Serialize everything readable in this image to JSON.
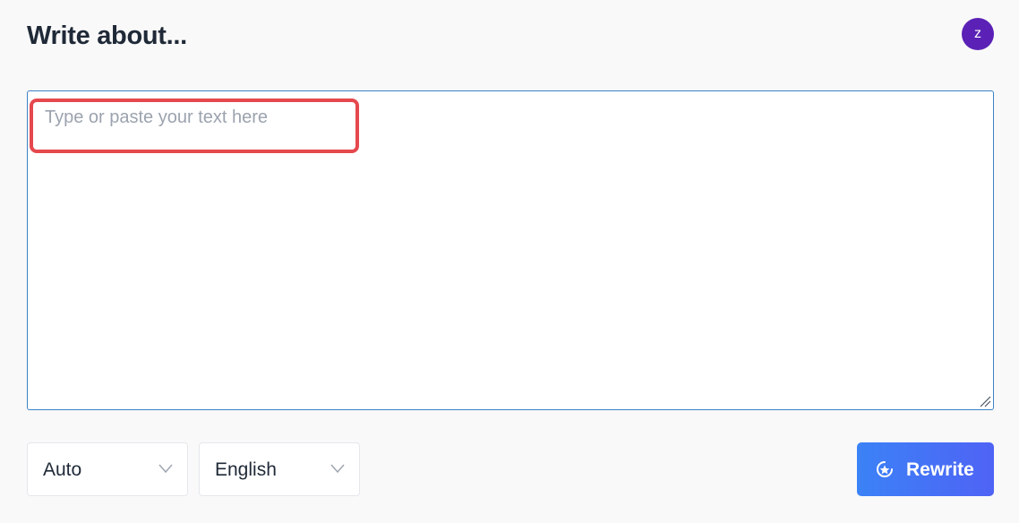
{
  "header": {
    "title": "Write about...",
    "avatar_initial": "z"
  },
  "editor": {
    "placeholder": "Type or paste your text here",
    "value": ""
  },
  "controls": {
    "tone_select": {
      "selected": "Auto"
    },
    "language_select": {
      "selected": "English"
    },
    "rewrite_label": "Rewrite"
  },
  "colors": {
    "background": "#f9f9f9",
    "title": "#1f2937",
    "avatar": "#5b21b6",
    "editor_border": "#3b82c4",
    "highlight": "#e5484d",
    "button_gradient_start": "#3b82f6",
    "button_gradient_end": "#4f63f5"
  },
  "icons": {
    "avatar": "user-avatar",
    "select_arrow": "chevron-down-icon",
    "rewrite": "sparkle-icon",
    "resize": "resize-handle-icon"
  }
}
